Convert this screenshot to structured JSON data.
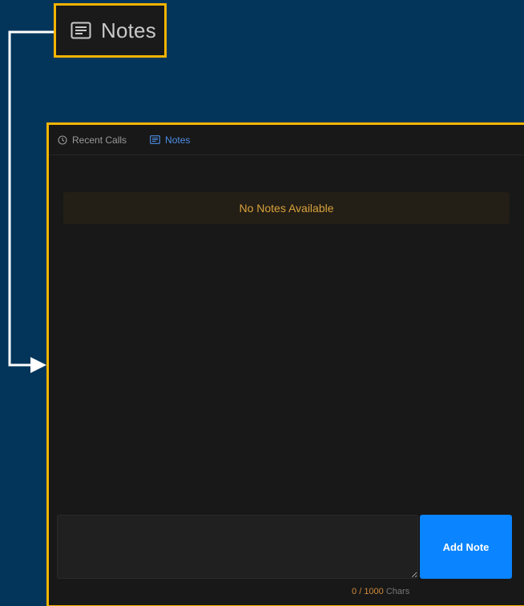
{
  "callout": {
    "label": "Notes",
    "icon": "notes-icon"
  },
  "tabs": [
    {
      "label": "Recent Calls",
      "icon": "clock-icon",
      "active": false
    },
    {
      "label": "Notes",
      "icon": "notes-icon",
      "active": true
    }
  ],
  "notes": {
    "empty_message": "No Notes Available",
    "input_value": "",
    "add_button_label": "Add Note",
    "char_count": "0",
    "char_max": "1000",
    "char_unit": "Chars"
  },
  "colors": {
    "highlight": "#f5b400",
    "accent": "#0a84ff",
    "tab_active": "#4d8ee6",
    "warning_text": "#d8a23a",
    "background": "#03355a"
  }
}
